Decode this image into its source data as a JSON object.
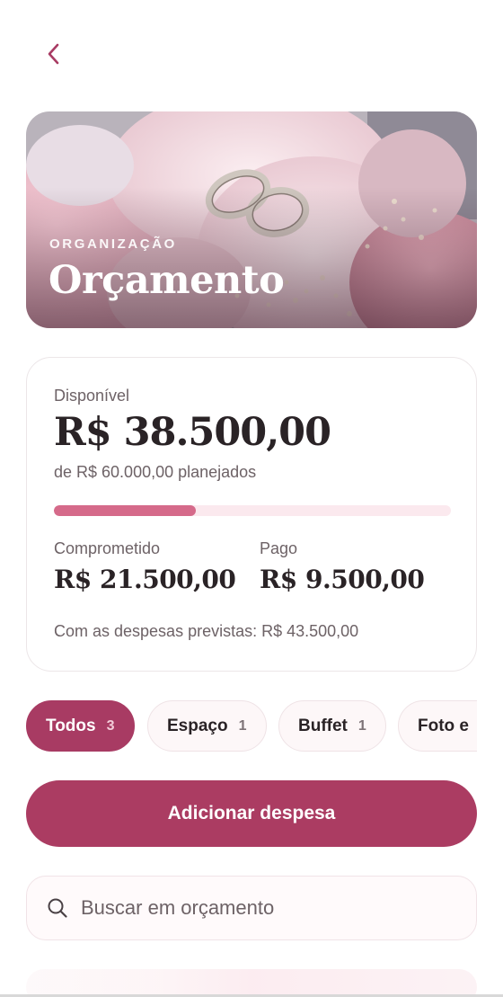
{
  "header": {
    "back_icon": "chevron-left-icon"
  },
  "hero": {
    "eyebrow": "ORGANIZAÇÃO",
    "title": "Orçamento"
  },
  "summary": {
    "available_label": "Disponível",
    "available_value": "R$ 38.500,00",
    "planned_text": "de R$ 60.000,00 planejados",
    "progress_fraction": 0.357,
    "committed_label": "Comprometido",
    "committed_value": "R$ 21.500,00",
    "paid_label": "Pago",
    "paid_value": "R$ 9.500,00",
    "forecast_text": "Com as despesas previstas: R$ 43.500,00"
  },
  "filters": [
    {
      "label": "Todos",
      "count": "3",
      "active": true
    },
    {
      "label": "Espaço",
      "count": "1",
      "active": false
    },
    {
      "label": "Buffet",
      "count": "1",
      "active": false
    },
    {
      "label": "Foto e",
      "count": "",
      "active": false
    }
  ],
  "add_button": {
    "label": "Adicionar despesa"
  },
  "search": {
    "placeholder": "Buscar em orçamento",
    "icon": "search-icon"
  },
  "colors": {
    "accent": "#ab3c62",
    "progress_fill": "#d56a8a",
    "progress_track": "#fbe9ee"
  }
}
